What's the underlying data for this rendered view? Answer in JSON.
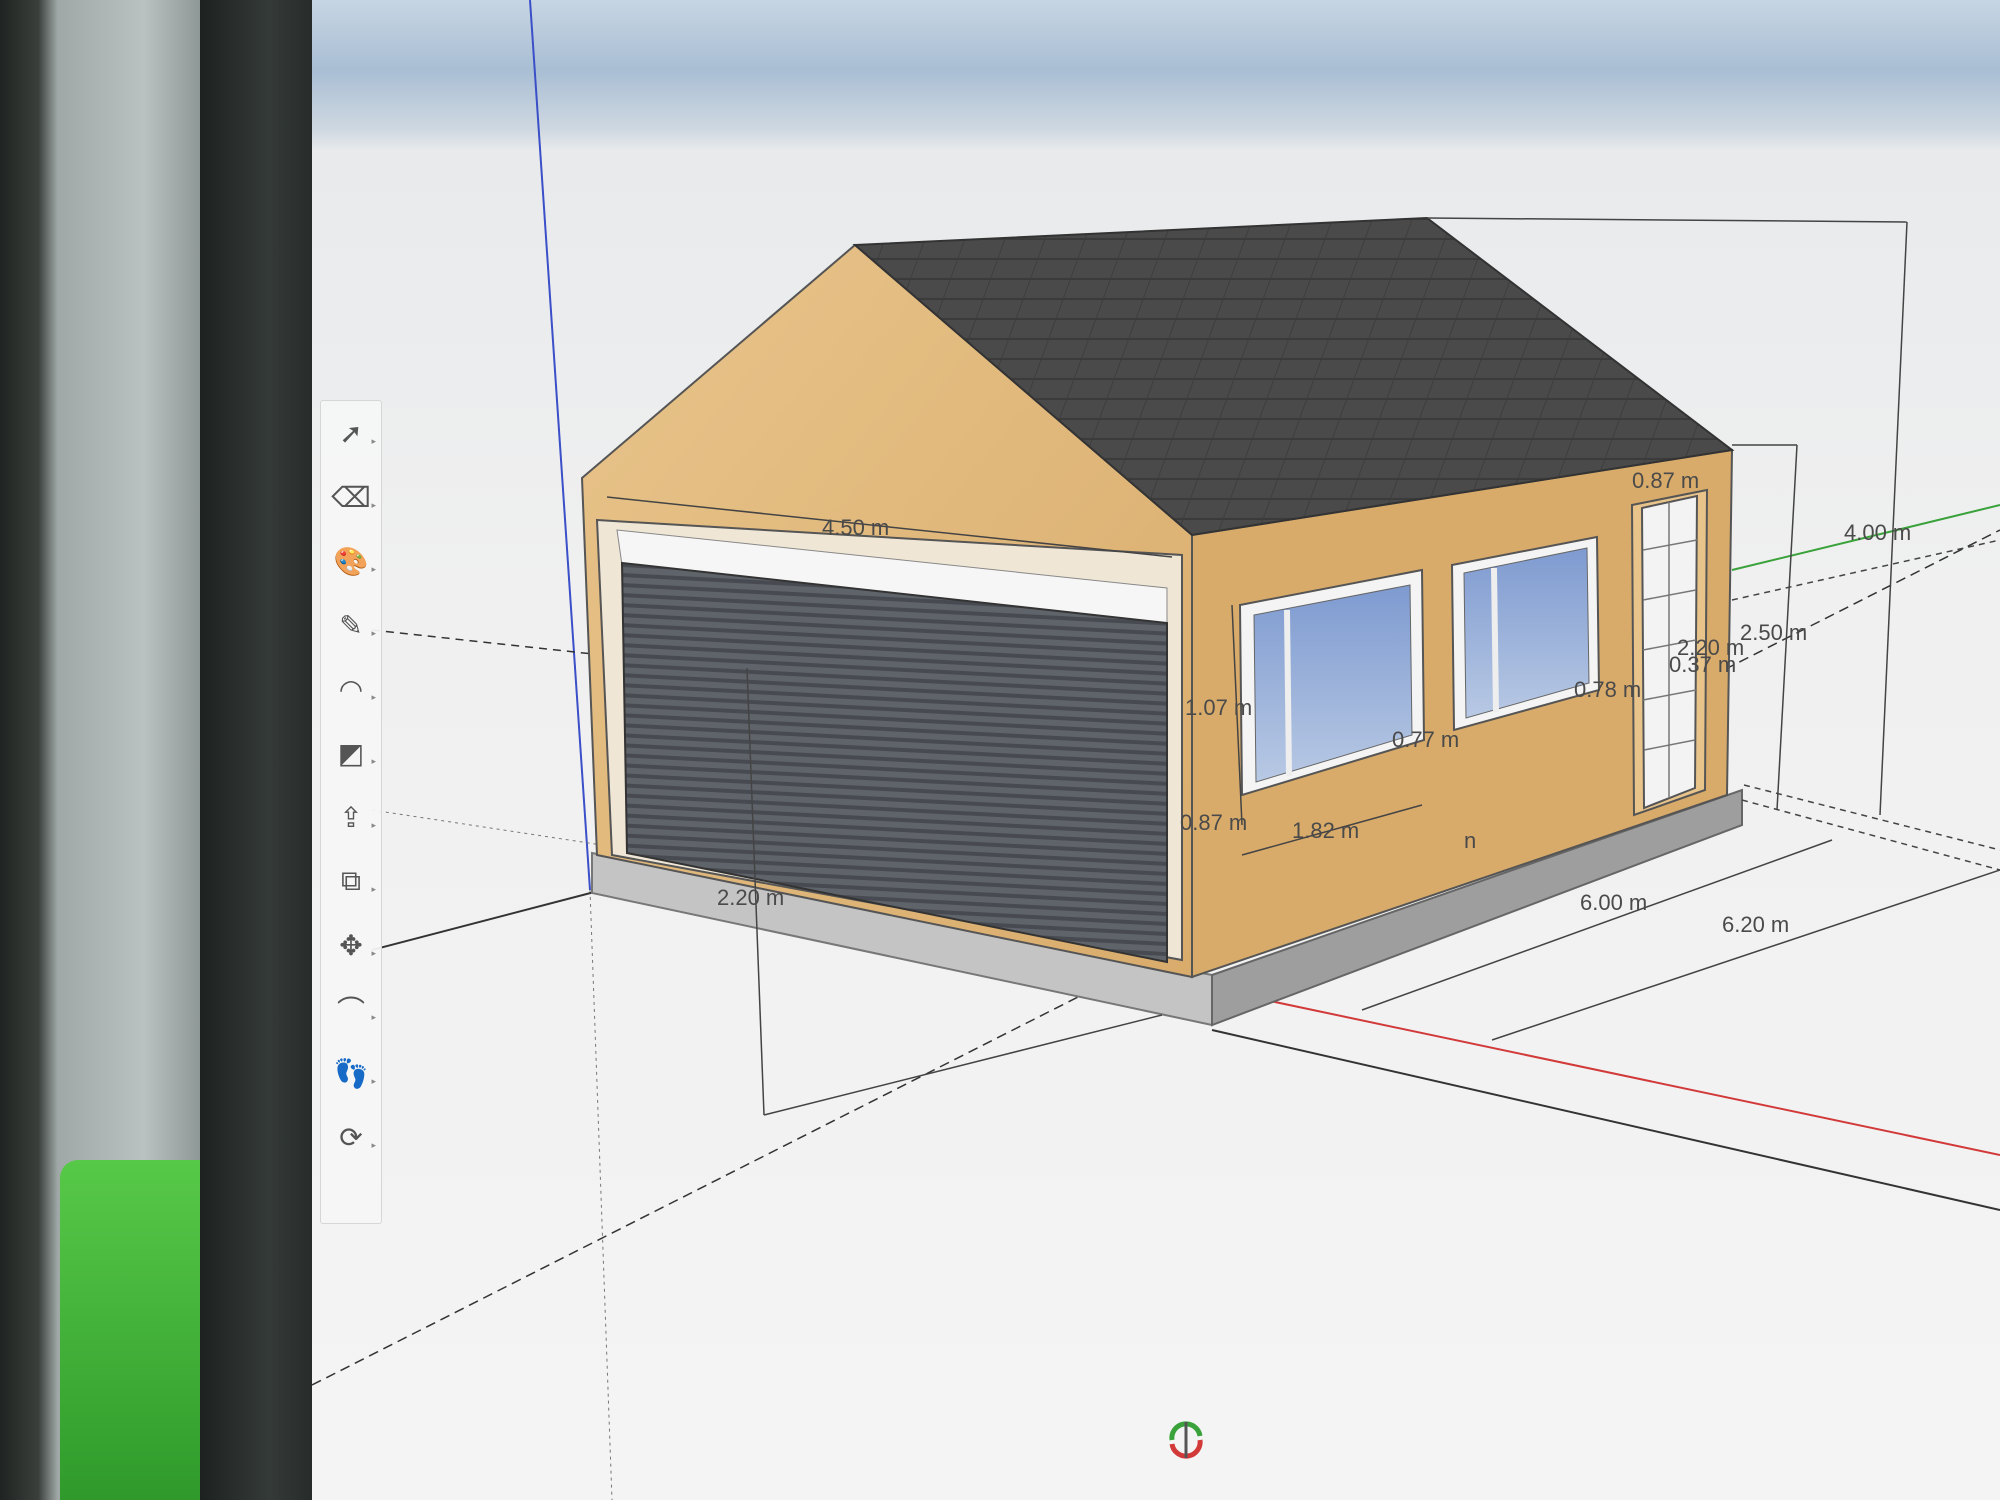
{
  "app": {
    "name": "3D modeling viewport"
  },
  "toolbar": {
    "tools": [
      {
        "id": "select",
        "icon": "arrow-cursor-icon",
        "glyph": "➚"
      },
      {
        "id": "eraser",
        "icon": "eraser-icon",
        "glyph": "⌫"
      },
      {
        "id": "paint",
        "icon": "paint-bucket-icon",
        "glyph": "🎨"
      },
      {
        "id": "pencil",
        "icon": "pencil-icon",
        "glyph": "✎"
      },
      {
        "id": "arc",
        "icon": "arc-icon",
        "glyph": "◠"
      },
      {
        "id": "rectangle",
        "icon": "rectangle-icon",
        "glyph": "◩"
      },
      {
        "id": "push-pull",
        "icon": "push-pull-icon",
        "glyph": "⇪"
      },
      {
        "id": "offset",
        "icon": "offset-icon",
        "glyph": "⧉"
      },
      {
        "id": "move",
        "icon": "move-icon",
        "glyph": "✥"
      },
      {
        "id": "tape",
        "icon": "tape-measure-icon",
        "glyph": "⌒"
      },
      {
        "id": "walk",
        "icon": "footprints-icon",
        "glyph": "👣"
      },
      {
        "id": "orbit",
        "icon": "orbit-icon",
        "glyph": "⟳"
      }
    ]
  },
  "dimensions": {
    "front_width": "4.50 m",
    "window_height": "1.07 m",
    "sill_height": "0.87 m",
    "window_width": "1.82 m",
    "window_gap": "0.77 m",
    "door_width": "0.87 m",
    "door_height": "2.20 m",
    "door_offset": "0.37 m",
    "door_sill": "0.78 m",
    "wall_height": "2.50 m",
    "ridge_height": "4.00 m",
    "garage_door_height": "2.20 m",
    "side_length": "6.00 m",
    "base_length": "6.20 m",
    "stray_label": "n"
  },
  "colors": {
    "wall": "#e2b77a",
    "roof": "#474747",
    "shutter": "#5c6066",
    "frame": "#f2f2f2",
    "glass": "#8ea6cf",
    "base": "#b3b3b3",
    "axis_red": "#d23a3a",
    "axis_green": "#3aa23a",
    "axis_blue": "#3a4fc8"
  }
}
